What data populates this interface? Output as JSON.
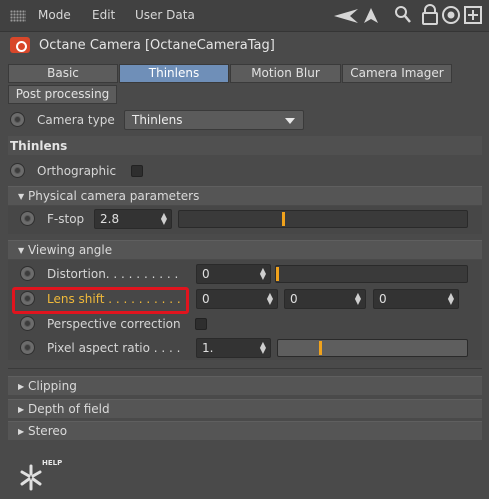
{
  "menubar": {
    "items": [
      "Mode",
      "Edit",
      "User Data"
    ],
    "icons": [
      "back-arrow-icon",
      "cursor-icon",
      "search-icon",
      "lock-icon",
      "target-icon",
      "new-panel-icon"
    ]
  },
  "title": "Octane Camera [OctaneCameraTag]",
  "tabs": [
    {
      "label": "Basic",
      "active": false
    },
    {
      "label": "Thinlens",
      "active": true
    },
    {
      "label": "Motion Blur",
      "active": false
    },
    {
      "label": "Camera Imager",
      "active": false
    },
    {
      "label": "Post processing",
      "active": false
    }
  ],
  "camera_type": {
    "label": "Camera type",
    "value": "Thinlens"
  },
  "section_title": "Thinlens",
  "orthographic": {
    "label": "Orthographic",
    "checked": false
  },
  "physical": {
    "header": "Physical camera parameters",
    "fstop": {
      "label": "F-stop",
      "value": "2.8",
      "slider_fraction": 0.36
    }
  },
  "viewing": {
    "header": "Viewing angle",
    "distortion": {
      "label": "Distortion. . . . . . . . . .",
      "value": "0",
      "slider_fraction": 0.0
    },
    "lens_shift": {
      "label": "Lens shift . . . . . . . . . .",
      "values": [
        "0",
        "0",
        "0"
      ],
      "highlighted": true
    },
    "perspective": {
      "label": "Perspective correction",
      "checked": false
    },
    "pixel_aspect": {
      "label": "Pixel aspect ratio . . . .",
      "value": "1.",
      "slider_fraction": 0.22
    }
  },
  "collapsed_sections": [
    "Clipping",
    "Depth of field",
    "Stereo"
  ],
  "help": {
    "label": "HELP"
  },
  "colors": {
    "accent": "#6f8fb8",
    "highlight": "#e0141e",
    "marker": "#f0a21c",
    "label_highlight": "#f0b93a"
  }
}
